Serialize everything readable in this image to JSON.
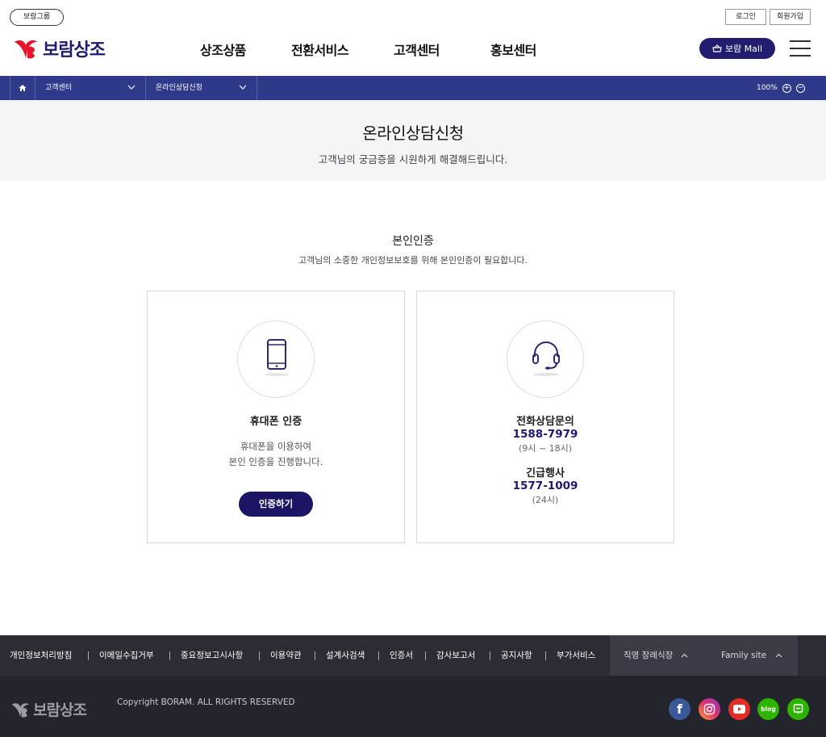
{
  "header": {
    "group_label": "보람그룹",
    "logo_text": "보람상조",
    "nav": [
      "상조상품",
      "전환서비스",
      "고객센터",
      "홍보센터"
    ],
    "login_label": "로그인",
    "signup_label": "회원가입",
    "mall_label": "보람 Mall"
  },
  "location": {
    "items": [
      "고객센터",
      "온라인상담신청"
    ],
    "zoom": "100%"
  },
  "page": {
    "title": "온라인상담신청",
    "subtitle": "고객님의 궁금증을 시원하게 해결해드립니다."
  },
  "verify": {
    "title": "본인인증",
    "desc": "고객님의 소중한 개인정보보호를 위해 본인인증이 필요합니다.",
    "phone_card": {
      "title": "휴대폰 인증",
      "desc_line1": "휴대폰을 이용하여",
      "desc_line2": "본인 인증을 진행합니다.",
      "button": "인증하기"
    },
    "call_card": {
      "label1": "전화상담문의",
      "number1": "1588-7979",
      "hours1": "(9시 ~ 18시)",
      "label2": "긴급행사",
      "number2": "1577-1009",
      "hours2": "(24시)"
    }
  },
  "footer": {
    "links": [
      "개인정보처리방침",
      "이메일수집거부",
      "중요정보고시사항",
      "이용약관",
      "설계사검색",
      "인증서",
      "감사보고서",
      "공지사항",
      "부가서비스"
    ],
    "dropdown1": "직영 장례식장",
    "dropdown2": "Family site",
    "logo_text": "보람상조",
    "copyright": "Copyright BORAM. ALL RIGHTS RESERVED",
    "sns": [
      "facebook-icon",
      "instagram-icon",
      "youtube-icon",
      "blog-icon",
      "post-icon"
    ],
    "blog_label": "blog"
  },
  "colors": {
    "brand_navy": "#1c1465",
    "loc_bar": "#2f3b8a",
    "logo_red": "#e3162a"
  }
}
